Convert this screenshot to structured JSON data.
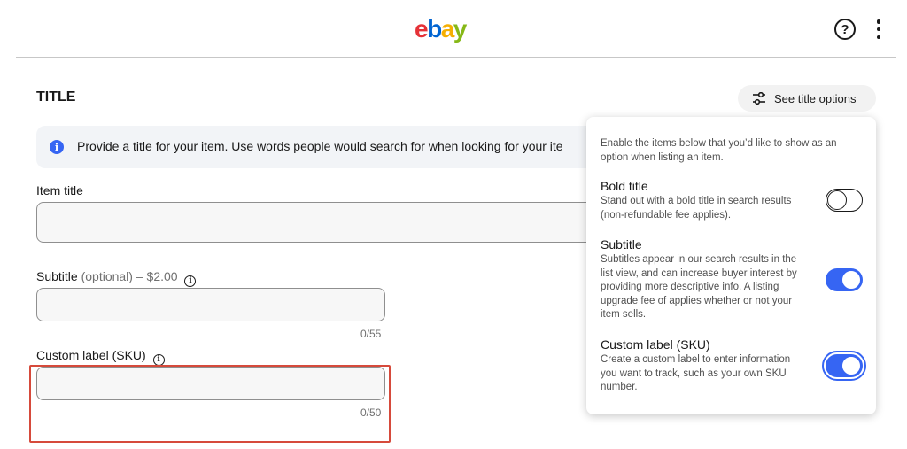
{
  "header": {
    "logo": {
      "e": "e",
      "b": "b",
      "a": "a",
      "y": "y"
    },
    "help_icon_glyph": "?",
    "icons": [
      "help-icon",
      "more-options-icon"
    ],
    "brand_colors": {
      "e": "#e53238",
      "b": "#0064d2",
      "a": "#f5af02",
      "y": "#86b817"
    }
  },
  "section": {
    "title": "TITLE",
    "see_options_label": "See title options",
    "banner_text": "Provide a title for your item. Use words people would search for when looking for your ite"
  },
  "fields": {
    "item_title": {
      "label": "Item title",
      "value": ""
    },
    "subtitle": {
      "label": "Subtitle",
      "optional": "(optional)",
      "price": "– $2.00",
      "value": "",
      "counter": "0/55"
    },
    "custom_label": {
      "label": "Custom label (SKU)",
      "value": "",
      "counter": "0/50"
    }
  },
  "title_options": {
    "intro": "Enable the items below that you’d like to show as an option when listing an item.",
    "items": [
      {
        "title": "Bold title",
        "description": "Stand out with a bold title in search results (non-refundable fee applies).",
        "enabled": false
      },
      {
        "title": "Subtitle",
        "description": "Subtitles appear in our search results in the list view, and can increase buyer interest by providing more descriptive info. A listing upgrade fee of applies whether or not your item sells.",
        "enabled": true
      },
      {
        "title": "Custom label (SKU)",
        "description": "Create a custom label to enter information you want to track, such as your own SKU number.",
        "enabled": true
      }
    ]
  },
  "colors": {
    "accent": "#3665f3",
    "highlight_border": "#d64a3b"
  }
}
